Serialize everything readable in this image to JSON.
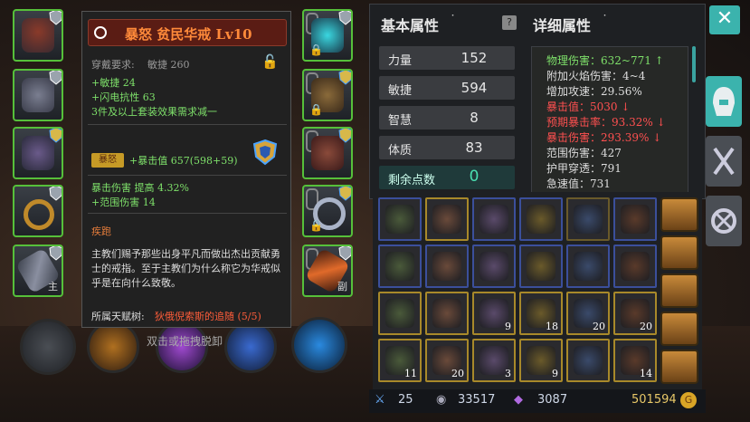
{
  "tooltip": {
    "item_name": "暴怒 贫民华戒 Lv10",
    "requirement_label": "穿戴要求:",
    "requirement_value": "敏捷 260",
    "bonuses": [
      "+敏捷 24",
      "+闪电抗性 63",
      "3件及以上套装效果需求减一"
    ],
    "set_badge": "暴怒",
    "set_bonus": "+暴击值 657(598+59)",
    "affixes": [
      "暴击伤害 提高 4.32%",
      "+范围伤害 14"
    ],
    "skill_name": "疾跑",
    "flavor": "主教们赐予那些出身平凡而做出杰出贡献勇士的戒指。至于主教们为什么称它为华戒似乎是在向什么致敬。",
    "talent_label": "所属天赋树:",
    "talent_value": "狄俄倪索斯的追随 (5/5)"
  },
  "equipment": {
    "left_tags": [
      "",
      "",
      "",
      "",
      "主"
    ],
    "right_tags": [
      "",
      "",
      "",
      "",
      "副"
    ]
  },
  "stats": {
    "basic_title": "基本属性",
    "detail_title": "详细属性",
    "basic": [
      {
        "label": "力量",
        "value": "152"
      },
      {
        "label": "敏捷",
        "value": "594"
      },
      {
        "label": "智慧",
        "value": "8"
      },
      {
        "label": "体质",
        "value": "83"
      }
    ],
    "remaining_label": "剩余点数",
    "remaining_value": "0",
    "detail": [
      {
        "text": "物理伤害：632~771 ↑",
        "color": "#7ee06a"
      },
      {
        "text": "附加火焰伤害：4~4",
        "color": "#dddddd"
      },
      {
        "text": "增加攻速：29.56%",
        "color": "#dddddd"
      },
      {
        "text": "暴击值：5030 ↓",
        "color": "#ff5050"
      },
      {
        "text": "预期暴击率：93.32% ↓",
        "color": "#ff5050"
      },
      {
        "text": "暴击伤害：293.39% ↓",
        "color": "#ff5050"
      },
      {
        "text": "范围伤害：427",
        "color": "#dddddd"
      },
      {
        "text": "护甲穿透：791",
        "color": "#dddddd"
      },
      {
        "text": "急速值：731",
        "color": "#dddddd"
      }
    ]
  },
  "bag": {
    "counts": [
      "",
      "",
      "",
      "",
      "",
      "",
      "",
      "",
      "",
      "",
      "",
      "",
      "",
      "",
      "9",
      "18",
      "20",
      "20",
      "11",
      "20",
      "3",
      "9",
      "",
      "14"
    ]
  },
  "currency": {
    "gem_blue": "25",
    "silver": "33517",
    "crystal": "3087",
    "gold": "501594"
  },
  "hint_text": "双击或拖拽脱卸",
  "close_symbol": "✕"
}
